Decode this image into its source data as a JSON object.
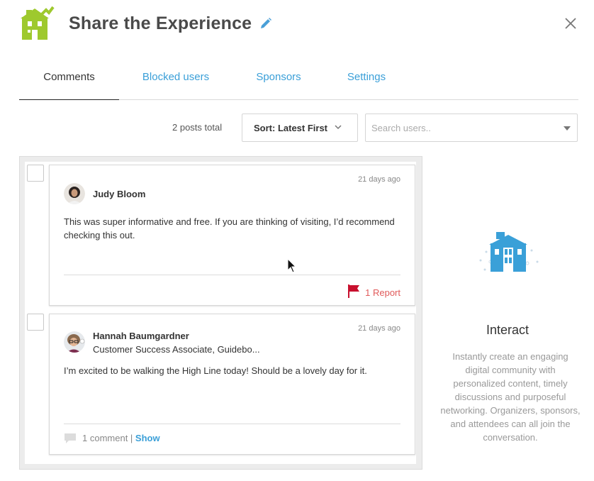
{
  "header": {
    "title": "Share the Experience",
    "logo_icon": "building-logo-icon",
    "edit_icon": "pencil-icon",
    "close_icon": "close-icon"
  },
  "tabs": [
    {
      "label": "Comments",
      "active": true
    },
    {
      "label": "Blocked users",
      "active": false
    },
    {
      "label": "Sponsors",
      "active": false
    },
    {
      "label": "Settings",
      "active": false
    }
  ],
  "toolbar": {
    "post_count": "2 posts total",
    "sort_label": "Sort: Latest First",
    "search_placeholder": "Search users.."
  },
  "posts": [
    {
      "author": "Judy Bloom",
      "time": "21 days ago",
      "text": "This was super informative and free. If you are thinking of visiting, I’d recommend checking this out.",
      "report_label": "1 Report"
    },
    {
      "author": "Hannah Baumgardner",
      "subtitle": "Customer Success Associate, Guidebo...",
      "time": "21 days ago",
      "text": "I’m excited to be walking the High Line today! Should be a lovely day for it.",
      "comments_label": "1 comment |",
      "show_label": "Show"
    }
  ],
  "side_panel": {
    "title": "Interact",
    "description": "Instantly create an engaging digital community with personalized content, timely discussions and purposeful networking. Organizers, sponsors, and attendees can all join the conversation."
  },
  "colors": {
    "accent": "#3a9fd8",
    "logo_green": "#9ec92e",
    "report_red": "#e05a5a",
    "flag_red": "#c8102e"
  }
}
